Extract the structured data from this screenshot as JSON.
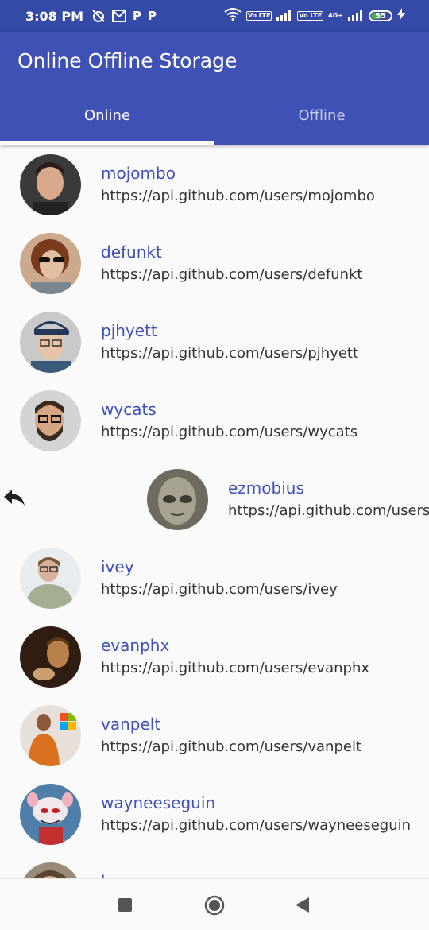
{
  "status_bar": {
    "time": "3:08 PM",
    "lte_label_1": "Vo LTE",
    "lte_label_2": "Vo LTE",
    "network_label": "4G+",
    "battery": "55",
    "icons": [
      "alarm-off-icon",
      "gmail-icon",
      "p-icon",
      "p-icon",
      "wifi-icon",
      "signal-icon",
      "signal-icon",
      "battery-icon",
      "charging-icon"
    ]
  },
  "app_bar": {
    "title": "Online Offline Storage",
    "tabs": [
      {
        "label": "Online",
        "selected": true
      },
      {
        "label": "Offline",
        "selected": false
      }
    ]
  },
  "users": [
    {
      "name": "mojombo",
      "url": "https://api.github.com/users/mojombo"
    },
    {
      "name": "defunkt",
      "url": "https://api.github.com/users/defunkt"
    },
    {
      "name": "pjhyett",
      "url": "https://api.github.com/users/pjhyett"
    },
    {
      "name": "wycats",
      "url": "https://api.github.com/users/wycats"
    },
    {
      "name": "ezmobius",
      "url": "https://api.github.com/users/ezmobius"
    },
    {
      "name": "ivey",
      "url": "https://api.github.com/users/ivey"
    },
    {
      "name": "evanphx",
      "url": "https://api.github.com/users/evanphx"
    },
    {
      "name": "vanpelt",
      "url": "https://api.github.com/users/vanpelt"
    },
    {
      "name": "wayneeseguin",
      "url": "https://api.github.com/users/wayneeseguin"
    },
    {
      "name": "b",
      "url": ""
    }
  ],
  "nav_bar": {
    "buttons": [
      "recents-square-icon",
      "home-circle-icon",
      "back-triangle-icon"
    ]
  },
  "colors": {
    "primary": "#3f51b5",
    "status_bar": "#3549a6",
    "background": "#fafafa"
  }
}
